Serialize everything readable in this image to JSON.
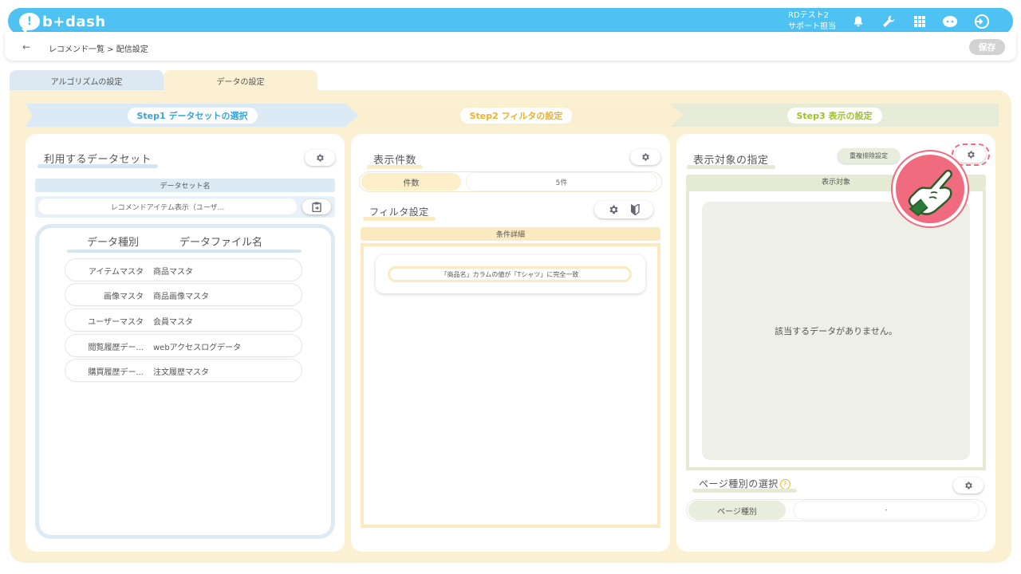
{
  "app": {
    "logo_text": "b+dash",
    "logo_mark": "!"
  },
  "header": {
    "user_line1": "RDテスト2",
    "user_line2": "サポート担当",
    "icons": [
      "bell-icon",
      "wrench-icon",
      "grid-icon",
      "chat-icon",
      "logout-icon"
    ]
  },
  "breadcrumb": {
    "back": "←",
    "text": "レコメンド一覧 > 配信設定"
  },
  "save_label": "保存",
  "tabs": [
    {
      "label": "アルゴリズムの設定",
      "active": false
    },
    {
      "label": "データの設定",
      "active": true
    }
  ],
  "steps": [
    {
      "label": "Step1 データセットの選択"
    },
    {
      "label": "Step2 フィルタの設定"
    },
    {
      "label": "Step3 表示の設定"
    }
  ],
  "panel1": {
    "title": "利用するデータセット",
    "dataset_header": "データセット名",
    "dataset_value": "レコメンドアイテム表示（ユーザ...",
    "col_kind": "データ種別",
    "col_file": "データファイル名",
    "rows": [
      {
        "kind": "アイテムマスタ",
        "file": "商品マスタ"
      },
      {
        "kind": "画像マスタ",
        "file": "商品画像マスタ"
      },
      {
        "kind": "ユーザーマスタ",
        "file": "会員マスタ"
      },
      {
        "kind": "閲覧履歴デー...",
        "file": "webアクセスログデータ"
      },
      {
        "kind": "購買履歴デー...",
        "file": "注文履歴マスタ"
      }
    ]
  },
  "panel2": {
    "title": "表示件数",
    "count_label": "件数",
    "count_value": "5件",
    "filter_title": "フィルタ設定",
    "cond_header": "条件詳細",
    "condition": "「商品名」カラムの値が「Tシャツ」に完全一致"
  },
  "panel3": {
    "title": "表示対象の指定",
    "dedup_label": "重複排除設定",
    "target_header": "表示対象",
    "empty_message": "該当するデータがありません。",
    "page_title": "ページ種別の選択",
    "help": "?",
    "page_label": "ページ種別",
    "page_value": "-"
  },
  "colors": {
    "brand": "#4ec2f3",
    "step1": "#3ba3d8",
    "step2": "#eab22d",
    "step3": "#9ec02a",
    "highlight": "#ef6b7d"
  }
}
